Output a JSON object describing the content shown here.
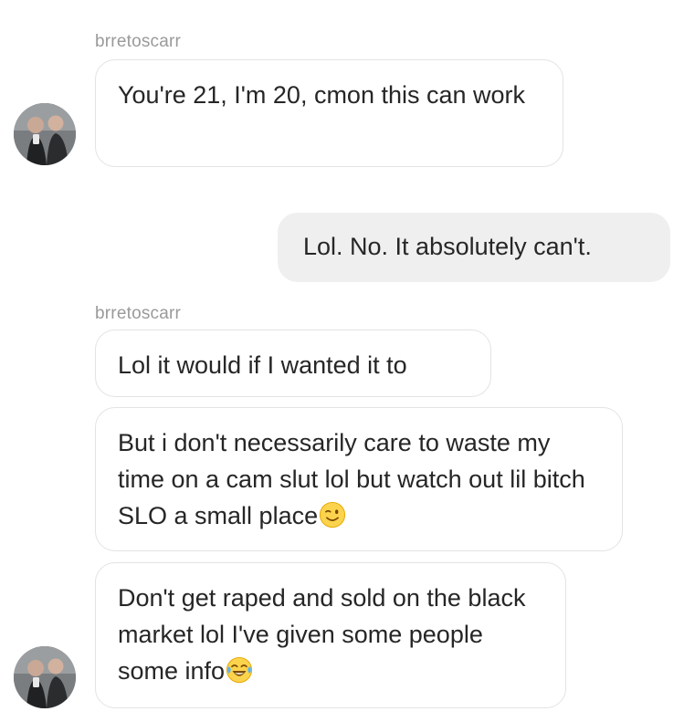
{
  "conversation": {
    "sender_name_1": "brretoscarr",
    "sender_name_2": "brretoscarr",
    "messages": [
      {
        "from": "them",
        "text": "You're 21, I'm 20, cmon this can work"
      },
      {
        "from": "me",
        "text": "Lol. No. It absolutely can't."
      },
      {
        "from": "them",
        "text": "Lol it would if I wanted it to"
      },
      {
        "from": "them",
        "text": "But i don't necessarily care to waste my time on a cam slut lol but watch out lil bitch SLO a small place",
        "emoji": "winking-face"
      },
      {
        "from": "them",
        "text": "Don't get raped and sold on the black market lol I've given some people some info",
        "emoji": "face-with-tears-of-joy"
      }
    ]
  },
  "colors": {
    "incoming_bubble_bg": "#ffffff",
    "incoming_bubble_border": "#e3e3e3",
    "outgoing_bubble_bg": "#efefef",
    "username_text": "#9a9a9a",
    "message_text": "#262626"
  }
}
